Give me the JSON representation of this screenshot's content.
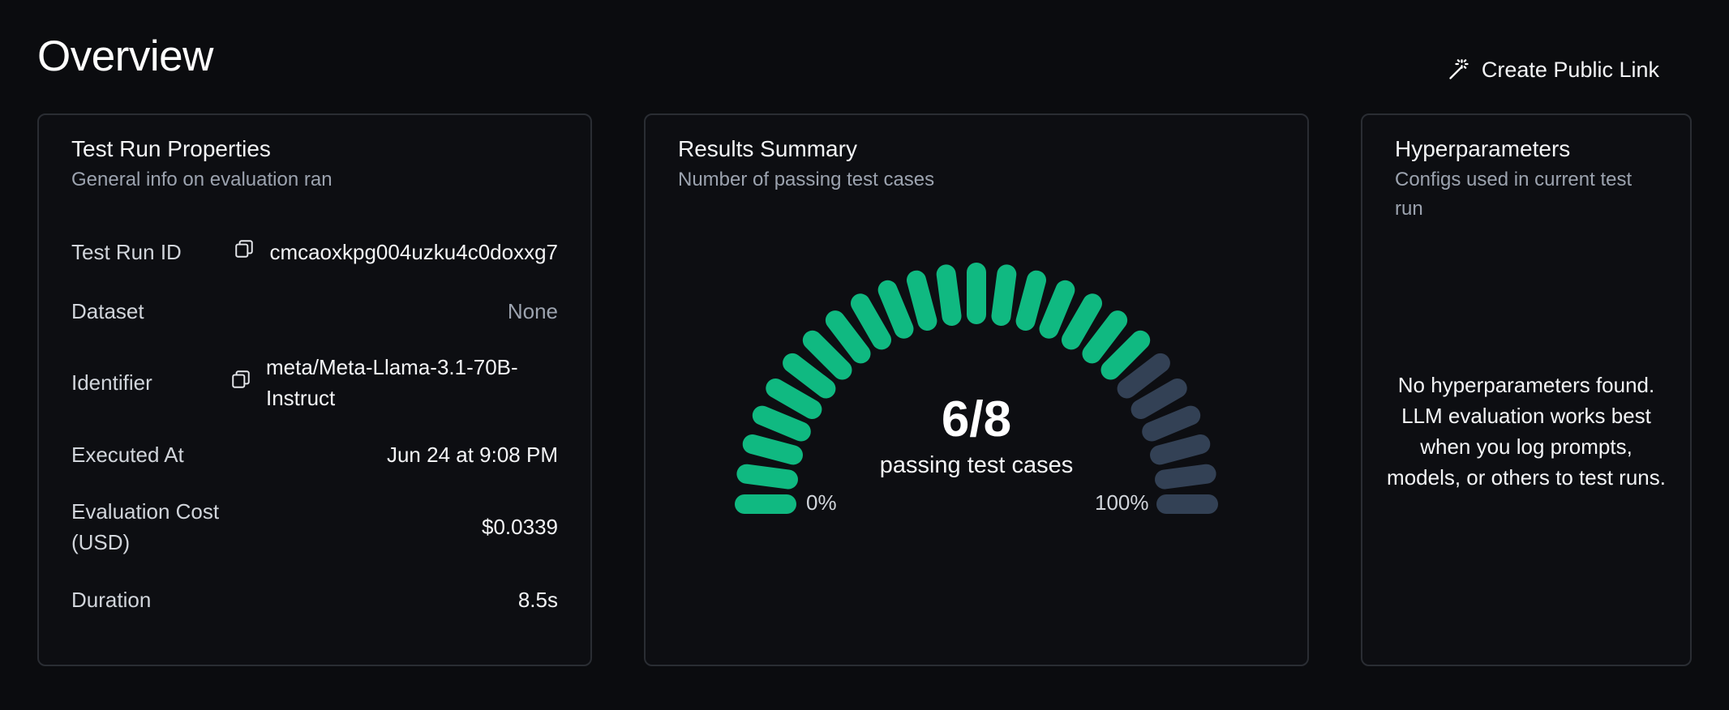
{
  "page": {
    "title": "Overview",
    "public_link_label": "Create Public Link",
    "public_link_icon": "magic-wand-icon"
  },
  "test_run_properties": {
    "title": "Test Run Properties",
    "subtitle": "General info on evaluation ran",
    "rows": {
      "test_run_id": {
        "label": "Test Run ID",
        "value": "cmcaoxkpg004uzku4c0doxxg7"
      },
      "dataset": {
        "label": "Dataset",
        "value": "None"
      },
      "identifier": {
        "label": "Identifier",
        "value": "meta/Meta-Llama-3.1-70B-Instruct"
      },
      "executed_at": {
        "label": "Executed At",
        "value": "Jun 24 at 9:08 PM"
      },
      "evaluation_cost": {
        "label": "Evaluation Cost (USD)",
        "value": "$0.0339"
      },
      "duration": {
        "label": "Duration",
        "value": "8.5s"
      }
    },
    "copy_icon": "copy-icon"
  },
  "results_summary": {
    "title": "Results Summary",
    "subtitle": "Number of passing test cases",
    "passing": 6,
    "total": 8,
    "fraction_text": "6/8",
    "caption": "passing test cases",
    "min_label": "0%",
    "max_label": "100%",
    "colors": {
      "active": "#10b981",
      "inactive": "#334155"
    }
  },
  "hyperparameters": {
    "title": "Hyperparameters",
    "subtitle": "Configs used in current test run",
    "empty_message": "No hyperparameters found. LLM evaluation works best when you log prompts, models, or others to test runs."
  },
  "theme": {
    "background": "#0b0c0f",
    "card_border": "#2a2d33"
  }
}
